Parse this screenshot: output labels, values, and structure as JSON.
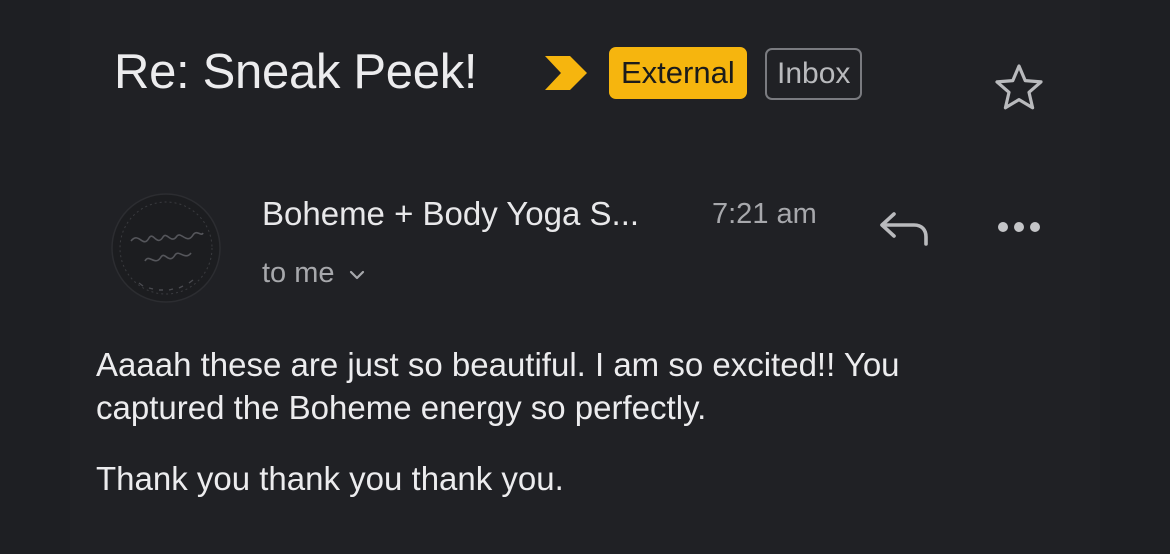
{
  "email": {
    "subject": "Re: Sneak Peek!",
    "labels": {
      "external": "External",
      "inbox": "Inbox"
    },
    "sender": {
      "name": "Boheme + Body Yoga S...",
      "time": "7:21 am",
      "recipient": "to me"
    },
    "body": [
      "Aaaah these are just so beautiful. I am so excited!! You captured the Boheme energy so perfectly.",
      "Thank you thank you thank you."
    ]
  },
  "icons": {
    "importance": "importance-marker-icon",
    "star": "star-icon",
    "reply": "reply-icon",
    "more": "more-options-icon",
    "expand": "chevron-down-icon"
  },
  "colors": {
    "background": "#202125",
    "external_label": "#f6b50e",
    "inbox_border": "#7a7b80",
    "text_primary": "#ececee",
    "text_secondary": "#a7a8ac"
  }
}
